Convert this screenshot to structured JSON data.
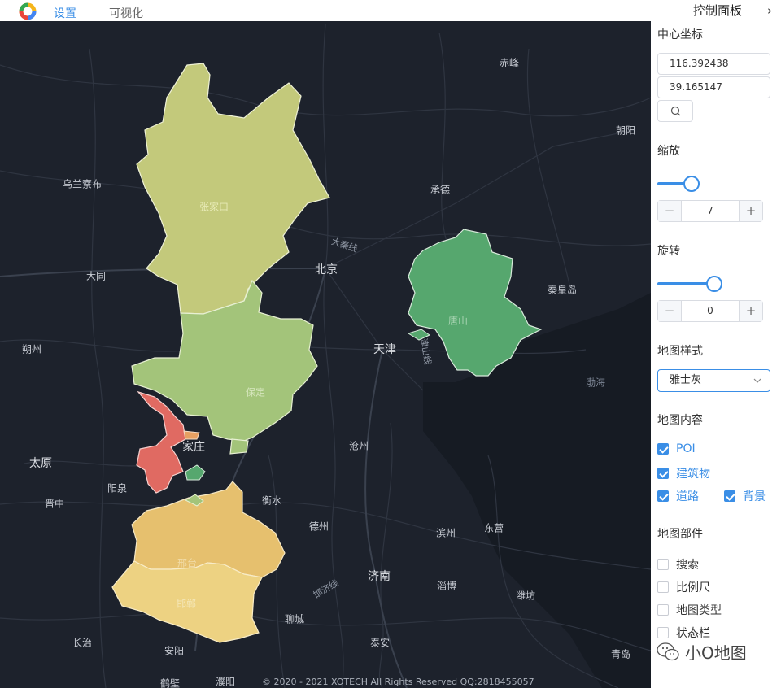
{
  "nav": {
    "tabs": [
      {
        "label": "设置",
        "active": true
      },
      {
        "label": "可视化",
        "active": false
      }
    ]
  },
  "panel": {
    "title": "控制面板",
    "center": {
      "label": "中心坐标",
      "lng": "116.392438",
      "lat": "39.165147"
    },
    "zoom": {
      "label": "缩放",
      "value": "7"
    },
    "rotate": {
      "label": "旋转",
      "value": "0"
    },
    "style": {
      "label": "地图样式",
      "selected": "雅士灰"
    },
    "content": {
      "label": "地图内容",
      "poi": "POI",
      "building": "建筑物",
      "road": "道路",
      "background": "背景"
    },
    "parts": {
      "label": "地图部件",
      "search": "搜索",
      "scale": "比例尺",
      "maptype": "地图类型",
      "statusbar": "状态栏"
    }
  },
  "map": {
    "cities": {
      "beijing": "北京",
      "tianjin": "天津",
      "chifeng": "赤峰",
      "chaoyang": "朝阳",
      "chengde": "承德",
      "ulanqab": "乌兰察布",
      "datong": "大同",
      "shuozhou": "朔州",
      "taiyuan": "太原",
      "jinzhong": "晋中",
      "yangquan": "阳泉",
      "qinhuangdao": "秦皇岛",
      "bohai": "渤海",
      "cangzhou": "沧州",
      "hengshui": "衡水",
      "dezhou": "德州",
      "binzhou": "滨州",
      "dongying": "东营",
      "jinan": "济南",
      "zibo": "淄博",
      "weifang": "潍坊",
      "liaocheng": "聊城",
      "taian": "泰安",
      "changzhi": "长治",
      "anyang": "安阳",
      "hebi": "鹤壁",
      "puyang": "濮阳",
      "qingdao": "青岛",
      "shijiazhuang": "家庄",
      "zhangjiakou": "张家口",
      "baoding": "保定",
      "tangshan": "唐山",
      "xingtai": "邢台",
      "handan": "邯郸"
    },
    "roads": {
      "daqin": "大秦线",
      "jinshan": "津山线",
      "handong": "邯济线"
    },
    "copyright": "© 2020 - 2021 XOTECH All Rights Reserved QQ:2818455057"
  },
  "watermark": {
    "text": "小O地图"
  },
  "colors": {
    "accent": "#3a8ee6",
    "map_bg": "#1d222c",
    "zhangjiakou": "#c3c97b",
    "baoding": "#a3c47a",
    "tangshan": "#56a76e",
    "shijiazhuang": "#e06a62",
    "xingtai": "#e6c06e",
    "handan": "#edd282"
  }
}
